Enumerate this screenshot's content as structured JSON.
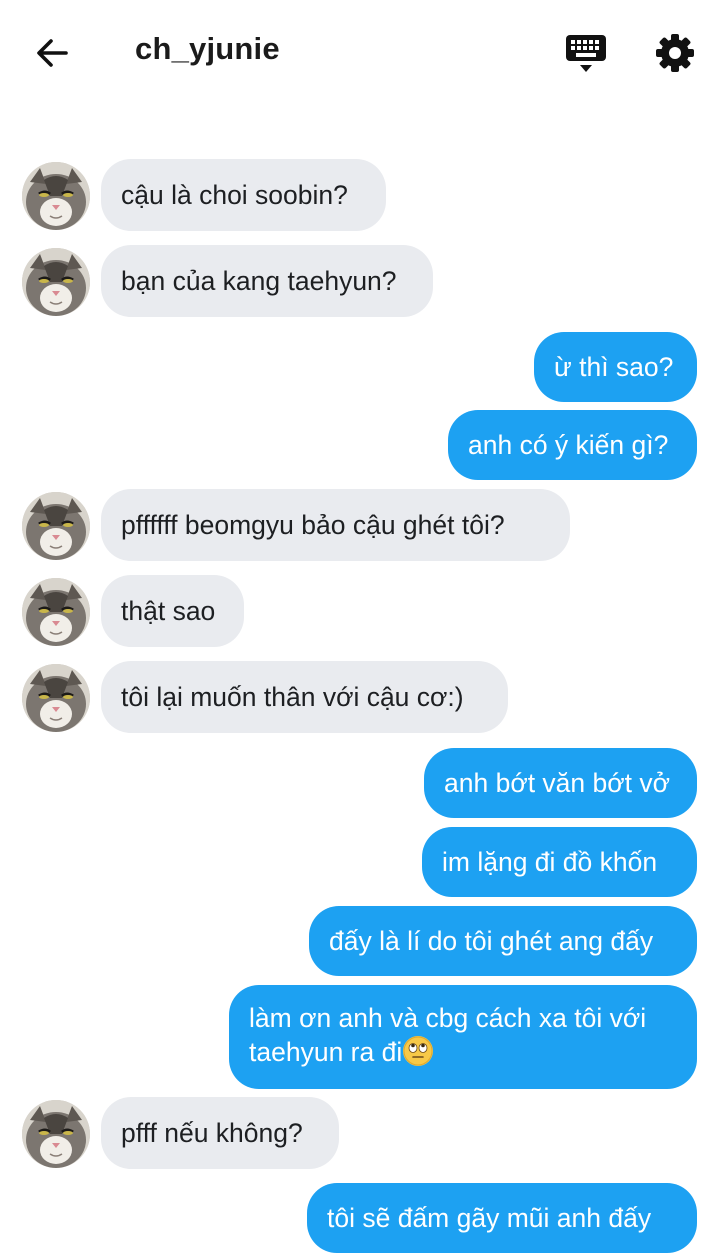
{
  "header": {
    "username": "ch_yjunie",
    "back_icon": "arrow-left-icon",
    "keyboard_icon": "keyboard-icon",
    "settings_icon": "gear-icon"
  },
  "colors": {
    "outgoing_bubble": "#1da1f2",
    "incoming_bubble": "#e9ebef",
    "outgoing_text": "#ffffff",
    "incoming_text": "#1d1f22"
  },
  "messages": [
    {
      "direction": "incoming",
      "text": "cậu là choi soobin?"
    },
    {
      "direction": "incoming",
      "text": "bạn của kang taehyun?"
    },
    {
      "direction": "outgoing",
      "text": "ừ thì sao?"
    },
    {
      "direction": "outgoing",
      "text": "anh có ý kiến gì?"
    },
    {
      "direction": "incoming",
      "text": "pffffff beomgyu bảo cậu ghét tôi?"
    },
    {
      "direction": "incoming",
      "text": "thật sao"
    },
    {
      "direction": "incoming",
      "text": "tôi lại muốn thân với cậu cơ:)"
    },
    {
      "direction": "outgoing",
      "text": "anh bớt văn bớt vở"
    },
    {
      "direction": "outgoing",
      "text": "im lặng đi đồ khốn"
    },
    {
      "direction": "outgoing",
      "text": "đấy là lí do tôi ghét ang đấy"
    },
    {
      "direction": "outgoing",
      "text": "làm ơn anh và cbg cách xa tôi với taehyun ra đi",
      "emoji": "face-with-rolling-eyes"
    },
    {
      "direction": "incoming",
      "text": "pfff nếu không?"
    },
    {
      "direction": "outgoing",
      "text": "tôi sẽ đấm gãy mũi anh đấy"
    }
  ]
}
